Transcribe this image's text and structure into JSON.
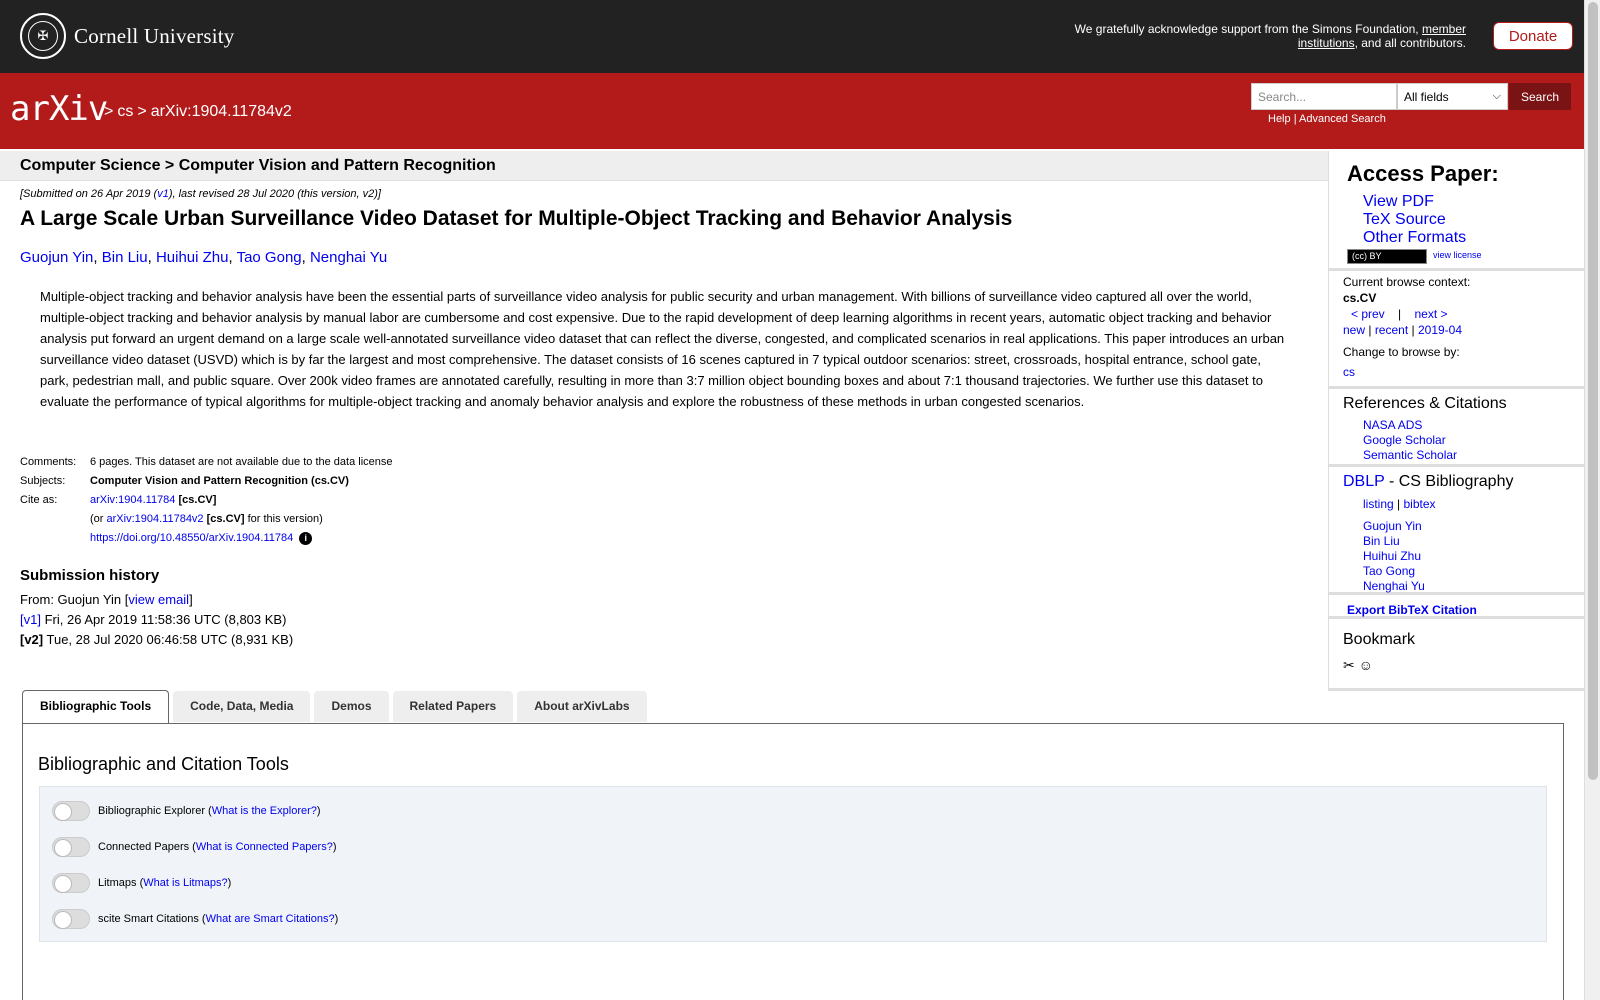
{
  "cornell": {
    "name": "Cornell University",
    "support_text": "We gratefully acknowledge support from the Simons Foundation,",
    "member_link": "member institutions",
    "support_tail": ", and all contributors.",
    "donate": "Donate"
  },
  "header": {
    "logo": "arXiv",
    "crumbs": [
      ">",
      "cs",
      ">",
      "arXiv:1904.11784v2"
    ],
    "search_placeholder": "Search...",
    "search_field": "All fields",
    "search_button": "Search",
    "help": "Help",
    "sep": "|",
    "advanced": "Advanced Search"
  },
  "subject_bar": "Computer Science > Computer Vision and Pattern Recognition",
  "paper": {
    "submitted_pre": "[Submitted on 26 Apr 2019 (",
    "submitted_v1": "v1",
    "submitted_post": "), last revised 28 Jul 2020 (this version, v2)]",
    "title": "A Large Scale Urban Surveillance Video Dataset for Multiple-Object Tracking and Behavior Analysis",
    "authors": [
      "Guojun Yin",
      "Bin Liu",
      "Huihui Zhu",
      "Tao Gong",
      "Nenghai Yu"
    ],
    "abstract": "Multiple-object tracking and behavior analysis have been the essential parts of surveillance video analysis for public security and urban management. With billions of surveillance video captured all over the world, multiple-object tracking and behavior analysis by manual labor are cumbersome and cost expensive. Due to the rapid development of deep learning algorithms in recent years, automatic object tracking and behavior analysis put forward an urgent demand on a large scale well-annotated surveillance video dataset that can reflect the diverse, congested, and complicated scenarios in real applications. This paper introduces an urban surveillance video dataset (USVD) which is by far the largest and most comprehensive. The dataset consists of 16 scenes captured in 7 typical outdoor scenarios: street, crossroads, hospital entrance, school gate, park, pedestrian mall, and public square. Over 200k video frames are annotated carefully, resulting in more than 3:7 million object bounding boxes and about 7:1 thousand trajectories. We further use this dataset to evaluate the performance of typical algorithms for multiple-object tracking and anomaly behavior analysis and explore the robustness of these methods in urban congested scenarios."
  },
  "meta": {
    "comments_label": "Comments:",
    "comments": "6 pages. This dataset are not available due to the data license",
    "subjects_label": "Subjects:",
    "subjects": "Computer Vision and Pattern Recognition (cs.CV)",
    "cite_label": "Cite as:",
    "cite_id": "arXiv:1904.11784",
    "cite_cat": "[cs.CV]",
    "cite_or": "(or",
    "cite_v2": "arXiv:1904.11784v2",
    "cite_v2_cat": "[cs.CV]",
    "cite_v2_tail": "for this version)",
    "doi": "https://doi.org/10.48550/arXiv.1904.11784"
  },
  "history": {
    "title": "Submission history",
    "from_pre": "From: Guojun Yin [",
    "view_email": "view email",
    "from_post": "]",
    "v1_label": "[v1]",
    "v1_text": "Fri, 26 Apr 2019 11:58:36 UTC (8,803 KB)",
    "v2_label": "[v2]",
    "v2_text": "Tue, 28 Jul 2020 06:46:58 UTC (8,931 KB)"
  },
  "sidebar": {
    "access_title": "Access Paper:",
    "access_links": [
      "View PDF",
      "TeX Source",
      "Other Formats"
    ],
    "license_badge": "(cc) BY",
    "view_license": "view license",
    "context_label": "Current browse context:",
    "context": "cs.CV",
    "prev": "< prev",
    "bar": "|",
    "next": "next >",
    "new": "new",
    "recent": "recent",
    "month": "2019-04",
    "change_label": "Change to browse by:",
    "cs": "cs",
    "refs_title": "References & Citations",
    "refs": [
      "NASA ADS",
      "Google Scholar",
      "Semantic Scholar"
    ],
    "dblp": "DBLP",
    "dblp_tail": " - CS Bibliography",
    "listing": "listing",
    "bibtex": "bibtex",
    "dblp_authors": [
      "Guojun Yin",
      "Bin Liu",
      "Huihui Zhu",
      "Tao Gong",
      "Nenghai Yu"
    ],
    "export": "Export BibTeX Citation",
    "bookmark": "Bookmark"
  },
  "tabs": [
    "Bibliographic Tools",
    "Code, Data, Media",
    "Demos",
    "Related Papers",
    "About arXivLabs"
  ],
  "panel": {
    "title": "Bibliographic and Citation Tools",
    "tools": [
      {
        "name": "Bibliographic Explorer",
        "link": "What is the Explorer?"
      },
      {
        "name": "Connected Papers",
        "link": "What is Connected Papers?"
      },
      {
        "name": "Litmaps",
        "link": "What is Litmaps?"
      },
      {
        "name": "scite Smart Citations",
        "link": "What are Smart Citations?"
      }
    ]
  }
}
